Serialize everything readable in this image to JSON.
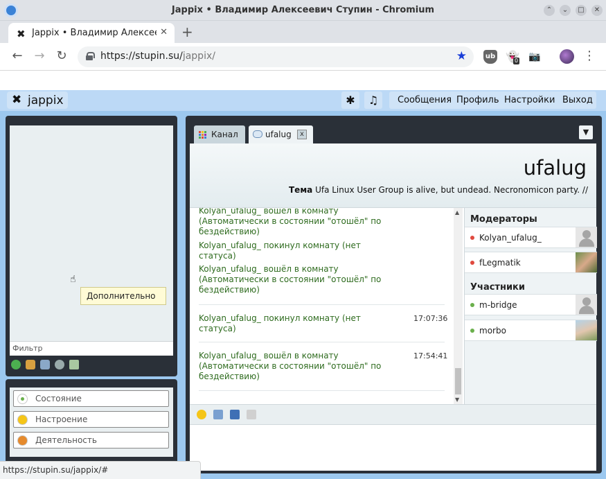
{
  "window": {
    "title": "Jappix • Владимир Алексеевич Ступин - Chromium"
  },
  "tab": {
    "label": "Jappix • Владимир Алексее",
    "close": "✕"
  },
  "newtab": "+",
  "nav": {
    "back": "←",
    "forward": "→",
    "reload": "↻"
  },
  "address": {
    "host": "https://stupin.su/",
    "path": "jappix/"
  },
  "extensions": {
    "ghost_badge": "0"
  },
  "jappix": {
    "logo_text": "jappix",
    "topbar_buttons": [
      "✱",
      "♫"
    ],
    "topnav": [
      "Сообщения",
      "Профиль",
      "Настройки",
      "Выход"
    ],
    "filter_placeholder": "Фильтр",
    "tooltip": "Дополнительно",
    "presence": [
      {
        "label": "Состояние",
        "icon": "status-dot-icon",
        "color": "#6ab04c"
      },
      {
        "label": "Настроение",
        "icon": "smiley-icon",
        "color": "#f5c518"
      },
      {
        "label": "Деятельность",
        "icon": "basketball-icon",
        "color": "#e58a2c"
      }
    ],
    "chat_tabs": [
      {
        "label": "Канал",
        "icon": "grid-icon"
      },
      {
        "label": "ufalug",
        "icon": "chat-bubble-icon",
        "close": "x"
      }
    ],
    "dropdown": "▼",
    "room": {
      "name": "ufalug",
      "topic_label": "Тема",
      "topic": "Ufa Linux User Group is alive, but undead. Necronomicon party. //"
    },
    "messages": [
      {
        "text": "Kolyan_ufalug_ вошёл в комнату (Автоматически в состоянии \"отошёл\" по бездействию)",
        "time": ""
      },
      {
        "text": "Kolyan_ufalug_ покинул комнату (нет статуса)",
        "time": ""
      },
      {
        "text": "Kolyan_ufalug_ вошёл в комнату (Автоматически в состоянии \"отошёл\" по бездействию)",
        "time": ""
      },
      {
        "text": "Kolyan_ufalug_ покинул комнату (нет статуса)",
        "time": "17:07:36"
      },
      {
        "text": "Kolyan_ufalug_ вошёл в комнату (Автоматически в состоянии \"отошёл\" по бездействию)",
        "time": "17:54:41"
      }
    ],
    "moderators_title": "Модераторы",
    "moderators": [
      {
        "name": "Kolyan_ufalug_",
        "status_color": "#e04a3f",
        "avatar": "default"
      },
      {
        "name": "fLegmatik",
        "status_color": "#e04a3f",
        "avatar": "photo"
      }
    ],
    "participants_title": "Участники",
    "participants": [
      {
        "name": "m-bridge",
        "status_color": "#6ab04c",
        "avatar": "default"
      },
      {
        "name": "morbo",
        "status_color": "#6ab04c",
        "avatar": "photo"
      }
    ]
  },
  "statusbar": "https://stupin.su/jappix/#"
}
